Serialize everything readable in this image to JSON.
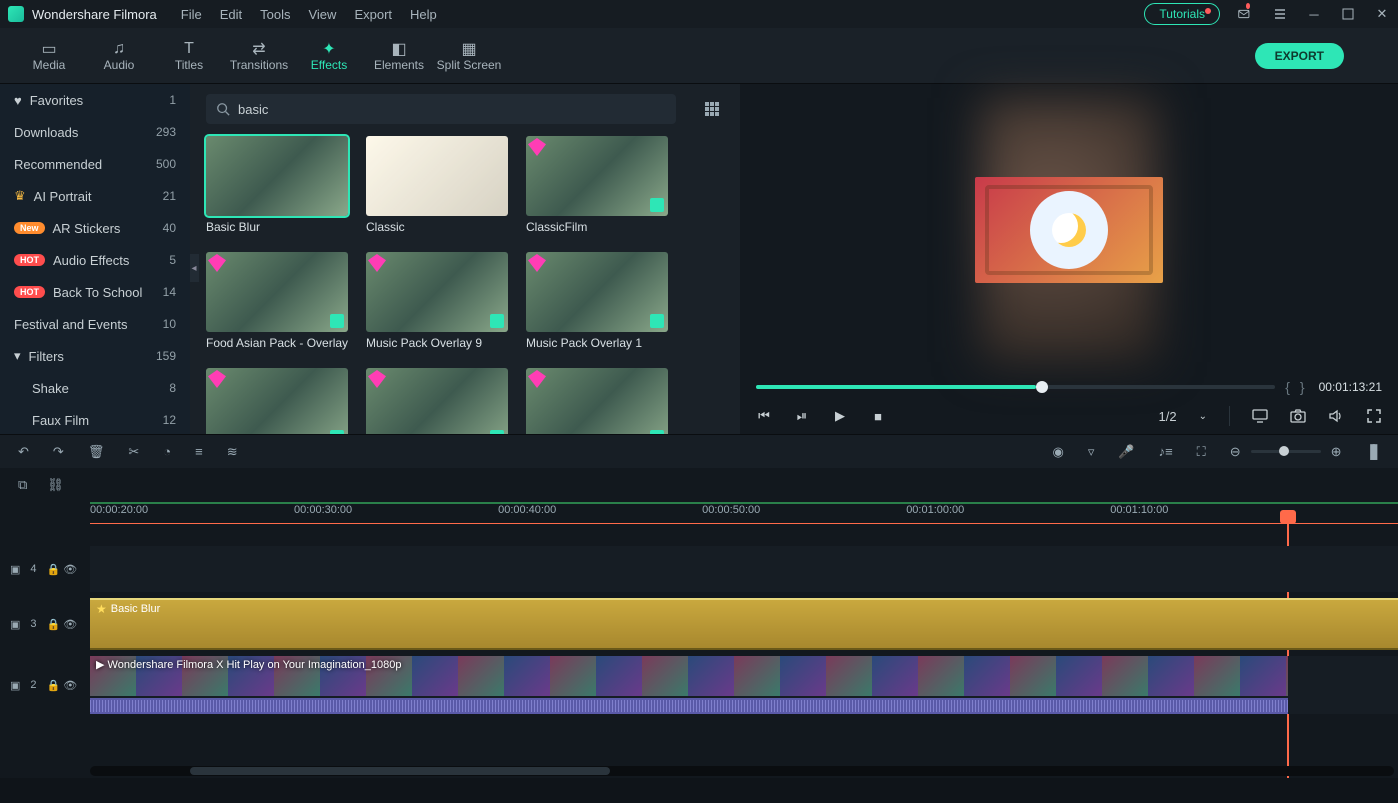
{
  "app": {
    "name": "Wondershare Filmora"
  },
  "menu": {
    "file": "File",
    "edit": "Edit",
    "tools": "Tools",
    "view": "View",
    "export": "Export",
    "help": "Help"
  },
  "titlebar": {
    "tutorials": "Tutorials"
  },
  "tabs": {
    "media": "Media",
    "audio": "Audio",
    "titles": "Titles",
    "transitions": "Transitions",
    "effects": "Effects",
    "elements": "Elements",
    "split": "Split Screen",
    "export": "EXPORT"
  },
  "sidebar": {
    "items": [
      {
        "label": "Favorites",
        "count": "1",
        "icon": "heart"
      },
      {
        "label": "Downloads",
        "count": "293"
      },
      {
        "label": "Recommended",
        "count": "500"
      },
      {
        "label": "AI Portrait",
        "count": "21",
        "icon": "crown"
      },
      {
        "label": "AR Stickers",
        "count": "40",
        "badge": "New"
      },
      {
        "label": "Audio Effects",
        "count": "5",
        "badge": "HOT"
      },
      {
        "label": "Back To School",
        "count": "14",
        "badge": "HOT"
      },
      {
        "label": "Festival and Events",
        "count": "10"
      },
      {
        "label": "Filters",
        "count": "159",
        "icon": "chevron"
      },
      {
        "label": "Shake",
        "count": "8",
        "indent": true
      },
      {
        "label": "Faux Film",
        "count": "12",
        "indent": true
      }
    ]
  },
  "search": {
    "placeholder": "",
    "value": "basic"
  },
  "effects": [
    {
      "label": "Basic Blur",
      "selected": true
    },
    {
      "label": "Classic",
      "classic": true
    },
    {
      "label": "ClassicFilm",
      "diamond": true,
      "dl": true
    },
    {
      "label": "Food Asian Pack - Overlay",
      "diamond": true,
      "dl": true
    },
    {
      "label": "Music Pack Overlay 9",
      "diamond": true,
      "dl": true
    },
    {
      "label": "Music Pack Overlay 1",
      "diamond": true,
      "dl": true
    },
    {
      "label": "",
      "diamond": true,
      "dl": true
    },
    {
      "label": "",
      "diamond": true,
      "dl": true
    },
    {
      "label": "",
      "diamond": true,
      "dl": true
    }
  ],
  "preview": {
    "timecode": "00:01:13:21",
    "ratio": "1/2",
    "scrub_pct": 54
  },
  "ruler": {
    "marks": [
      {
        "label": "00:00:20:00",
        "pct": 0
      },
      {
        "label": "00:00:30:00",
        "pct": 15.6
      },
      {
        "label": "00:00:40:00",
        "pct": 31.2
      },
      {
        "label": "00:00:50:00",
        "pct": 46.8
      },
      {
        "label": "00:01:00:00",
        "pct": 62.4
      },
      {
        "label": "00:01:10:00",
        "pct": 78.0
      }
    ],
    "playhead_pct": 91.5
  },
  "tracks": {
    "t4": "4",
    "t3": "3",
    "t2": "2",
    "blur_clip": "Basic Blur",
    "video_clip": "Wondershare Filmora X  Hit Play on Your Imagination_1080p"
  }
}
